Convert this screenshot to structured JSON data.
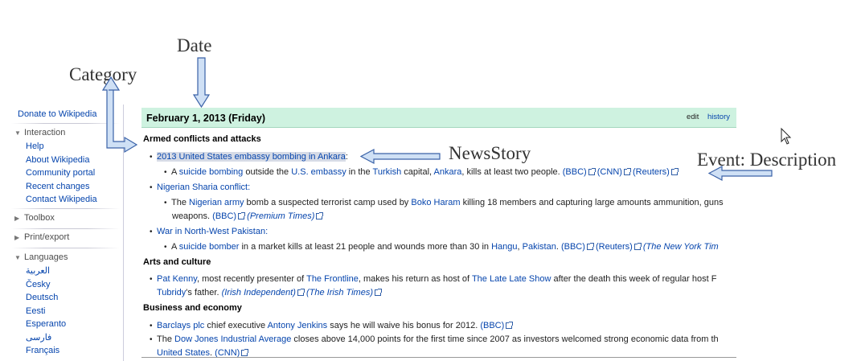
{
  "annotations": {
    "date": "Date",
    "category": "Category",
    "newsstory": "NewsStory",
    "event": "Event: Description"
  },
  "sidebar": {
    "donate": "Donate to Wikipedia",
    "interaction": {
      "title": "Interaction",
      "items": [
        "Help",
        "About Wikipedia",
        "Community portal",
        "Recent changes",
        "Contact Wikipedia"
      ]
    },
    "toolbox": "Toolbox",
    "print": "Print/export",
    "languages": {
      "title": "Languages",
      "items": [
        "العربية",
        "Česky",
        "Deutsch",
        "Eesti",
        "Esperanto",
        "فارسی",
        "Français"
      ]
    }
  },
  "header": {
    "date": "February 1, 2013 (Friday)",
    "edit": "edit",
    "history": "history"
  },
  "sections": {
    "armed": "Armed conflicts and attacks",
    "arts": "Arts and culture",
    "business": "Business and economy"
  },
  "stories": {
    "s1": "2013 United States embassy bombing in Ankara",
    "s2": "Nigerian Sharia conflict:",
    "s3": "War in North-West Pakistan:"
  },
  "text": {
    "e1": {
      "t1": "A ",
      "l1": "suicide bombing",
      "t2": " outside the ",
      "l2": "U.S. embassy",
      "t3": " in the ",
      "l3": "Turkish",
      "t4": " capital, ",
      "l4": "Ankara",
      "t5": ", kills at least two people. ",
      "r1": "(BBC)",
      "r2": "(CNN)",
      "r3": "(Reuters)"
    },
    "e2": {
      "t1": "The ",
      "l1": "Nigerian army",
      "t2": " bomb a suspected terrorist camp used by ",
      "l2": "Boko Haram",
      "t3": " killing 18 members and capturing large amounts ammunition, guns",
      "t4": "weapons. ",
      "r1": "(BBC)",
      "r2": "(Premium Times)"
    },
    "e3": {
      "t1": "A ",
      "l1": "suicide bomber",
      "t2": " in a market kills at least 21 people and wounds more than 30 in ",
      "l2": "Hangu",
      "t3": ", ",
      "l3": "Pakistan",
      "t4": ". ",
      "r1": "(BBC)",
      "r2": "(Reuters)",
      "r3": "(The New York Tim"
    },
    "e4": {
      "l1": "Pat Kenny",
      "t1": ", most recently presenter of ",
      "l2": "The Frontline",
      "t2": ", makes his return as host of ",
      "l3": "The Late Late Show",
      "t3": " after the death this week of regular host F",
      "l4": "Tubridy",
      "t4": "'s father. ",
      "r1": "(Irish Independent)",
      "r2": "(The Irish Times)"
    },
    "e5": {
      "l1": "Barclays plc",
      "t1": " chief executive ",
      "l2": "Antony Jenkins",
      "t2": " says he will waive his bonus for 2012. ",
      "r1": "(BBC)"
    },
    "e6": {
      "t1": "The ",
      "l1": "Dow Jones Industrial Average",
      "t2": " closes above 14,000 points for the first time since 2007 as investors welcomed strong economic data from th",
      "l2": "United States",
      "t3": ". ",
      "r1": "(CNN)"
    }
  },
  "colors": {
    "link": "#0645ad",
    "header_bg": "#cef2e0",
    "arrow_fill": "#cfe0f5",
    "arrow_stroke": "#3a62a8"
  }
}
